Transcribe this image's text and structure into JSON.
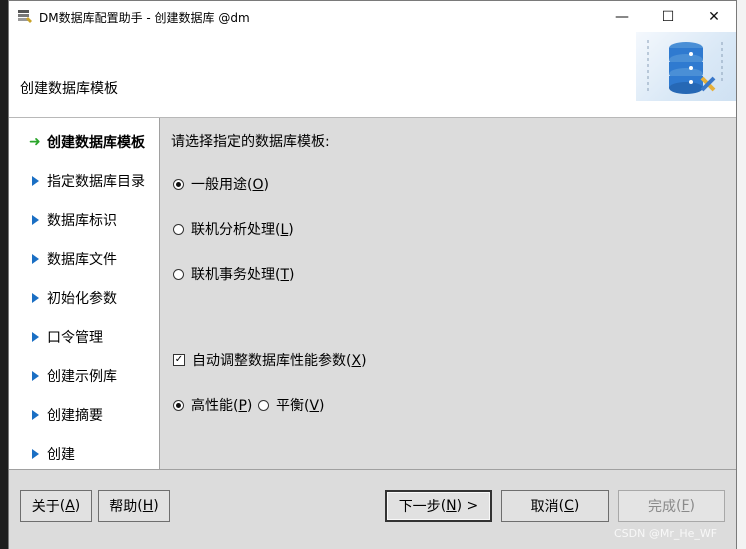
{
  "window": {
    "title": "DM数据库配置助手 - 创建数据库 @dm",
    "minimize_glyph": "—",
    "maximize_glyph": "☐",
    "close_glyph": "✕"
  },
  "header": {
    "title": "创建数据库模板",
    "art_icon": "database-gear-icon"
  },
  "sidebar": {
    "items": [
      {
        "label": "创建数据库模板",
        "active": true
      },
      {
        "label": "指定数据库目录",
        "active": false
      },
      {
        "label": "数据库标识",
        "active": false
      },
      {
        "label": "数据库文件",
        "active": false
      },
      {
        "label": "初始化参数",
        "active": false
      },
      {
        "label": "口令管理",
        "active": false
      },
      {
        "label": "创建示例库",
        "active": false
      },
      {
        "label": "创建摘要",
        "active": false
      },
      {
        "label": "创建",
        "active": false
      }
    ],
    "active_glyph": "➜"
  },
  "content": {
    "prompt": "请选择指定的数据库模板:",
    "templates": [
      {
        "label": "一般用途",
        "key": "O",
        "selected": true
      },
      {
        "label": "联机分析处理",
        "key": "L",
        "selected": false
      },
      {
        "label": "联机事务处理",
        "key": "T",
        "selected": false
      }
    ],
    "auto_tune": {
      "label": "自动调整数据库性能参数",
      "key": "X",
      "checked": true,
      "check_glyph": "✓"
    },
    "perf_modes": [
      {
        "label": "高性能",
        "key": "P",
        "selected": true
      },
      {
        "label": "平衡",
        "key": "V",
        "selected": false
      }
    ]
  },
  "footer": {
    "about": {
      "label": "关于",
      "key": "A"
    },
    "help": {
      "label": "帮助",
      "key": "H"
    },
    "next": {
      "label": "下一步",
      "key": "N",
      "suffix": " >"
    },
    "cancel": {
      "label": "取消",
      "key": "C"
    },
    "finish": {
      "label": "完成",
      "key": "F"
    }
  },
  "watermark": "CSDN @Mr_He_WF",
  "colors": {
    "active_arrow": "#2aa52a",
    "nav_triangle": "#1a6fc4",
    "panel_bg": "#dcdcdc"
  }
}
